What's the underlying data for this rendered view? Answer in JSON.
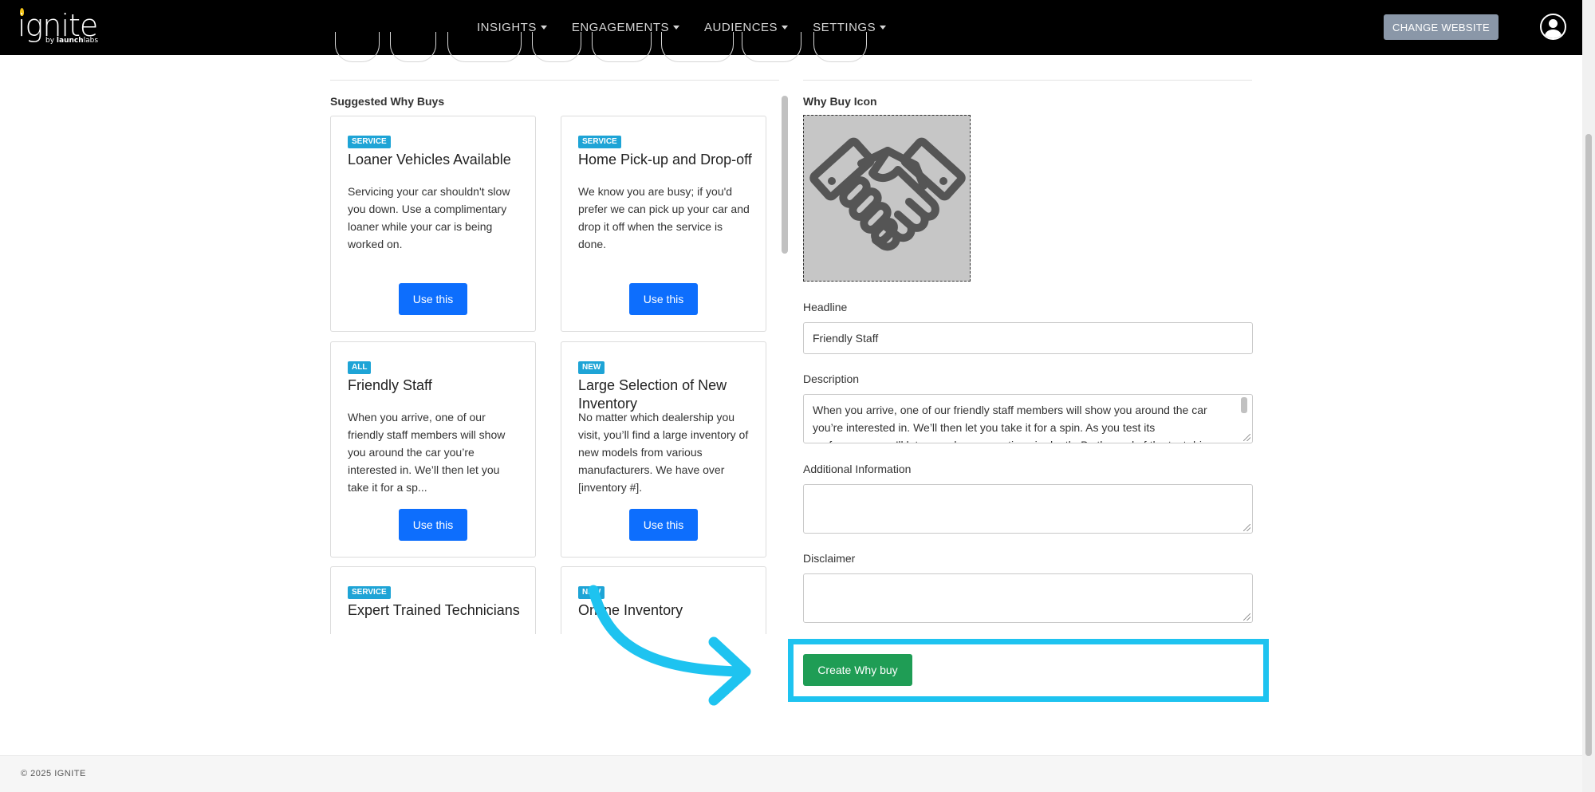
{
  "brand": {
    "logo_word": "ignite",
    "logo_sub_prefix": "by ",
    "logo_sub_bold": "launch",
    "logo_sub_suffix": "labs"
  },
  "nav": {
    "items": [
      {
        "label": "INSIGHTS"
      },
      {
        "label": "ENGAGEMENTS"
      },
      {
        "label": "AUDIENCES"
      },
      {
        "label": "SETTINGS"
      }
    ],
    "change_website_label": "CHANGE WEBSITE"
  },
  "suggested": {
    "title": "Suggested Why Buys",
    "cards": [
      {
        "badge": "SERVICE",
        "title": "Loaner Vehicles Available",
        "description": "Servicing your car shouldn't slow you down. Use a complimentary loaner while your car is being worked on.",
        "button": "Use this"
      },
      {
        "badge": "SERVICE",
        "title": "Home Pick-up and Drop-off",
        "description": "We know you are busy; if you'd prefer we can pick up your car and drop it off when the service is done.",
        "button": "Use this"
      },
      {
        "badge": "ALL",
        "title": "Friendly Staff",
        "description": "When you arrive, one of our friendly staff members will show you around the car you’re interested in. We’ll then let you take it for a sp...",
        "button": "Use this"
      },
      {
        "badge": "NEW",
        "title": "Large Selection of New Inventory",
        "description": "No matter which dealership you visit, you’ll find a large inventory of new models from various manufacturers. We have over [inventory #].",
        "button": "Use this"
      },
      {
        "badge": "SERVICE",
        "title": "Expert Trained Technicians",
        "description": "",
        "button": ""
      },
      {
        "badge": "NEW",
        "title": "Online Inventory",
        "description": "",
        "button": ""
      }
    ]
  },
  "form": {
    "icon_label": "Why Buy Icon",
    "icon_name": "handshake-icon",
    "headline_label": "Headline",
    "headline_value": "Friendly Staff",
    "description_label": "Description",
    "description_value": "When you arrive, one of our friendly staff members will show you around the car you’re interested in. We’ll then let you take it for a spin. As you test its performance, we’ll let you ask any questions in depth. By the end of the test drive",
    "additional_label": "Additional Information",
    "additional_value": "",
    "disclaimer_label": "Disclaimer",
    "disclaimer_value": "",
    "create_button": "Create Why buy"
  },
  "footer": {
    "copyright": "© 2025 IGNITE"
  },
  "colors": {
    "nav_bg": "#000000",
    "primary_button": "#0d6efd",
    "create_button": "#1f9d55",
    "badge": "#1ea4d6",
    "highlight": "#1ec3f0"
  }
}
